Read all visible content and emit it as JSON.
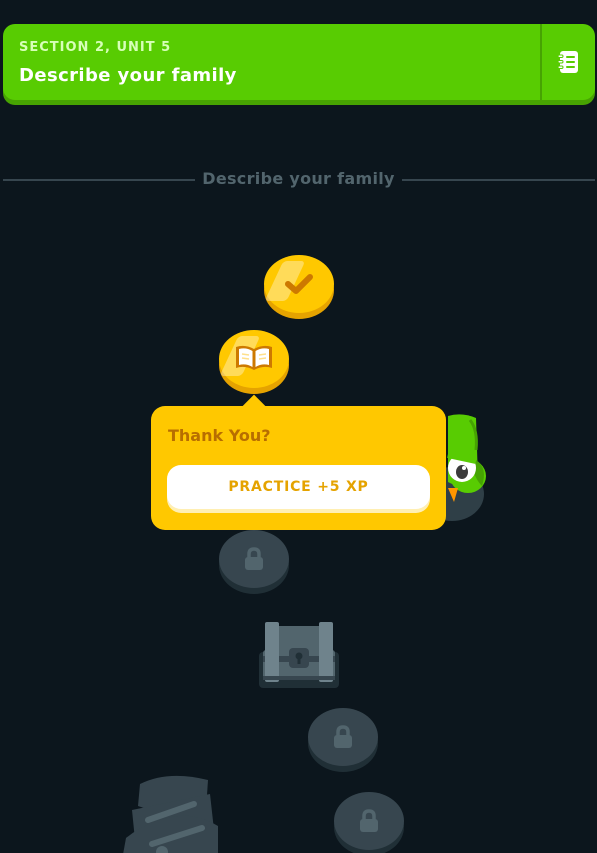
{
  "unit_header": {
    "section_label": "SECTION 2, UNIT 5",
    "title": "Describe your family",
    "guidebook_icon": "notebook-icon"
  },
  "divider": {
    "label": "Describe your family"
  },
  "path": {
    "nodes": [
      {
        "status": "completed",
        "icon": "check-icon"
      },
      {
        "status": "completed",
        "icon": "book-icon"
      },
      {
        "status": "locked",
        "icon": "lock-icon"
      },
      {
        "status": "locked",
        "icon": "treasure-chest-icon"
      },
      {
        "status": "locked",
        "icon": "lock-icon"
      },
      {
        "status": "locked",
        "icon": "lock-icon"
      },
      {
        "status": "locked",
        "icon": "trophy-icon"
      }
    ]
  },
  "popover": {
    "title": "Thank You?",
    "button_label": "PRACTICE +5 XP"
  },
  "colors": {
    "background": "#0c161d",
    "header_green": "#58cc02",
    "gold": "#ffc800",
    "locked_gray": "#37464f",
    "divider_text": "#52656d"
  }
}
